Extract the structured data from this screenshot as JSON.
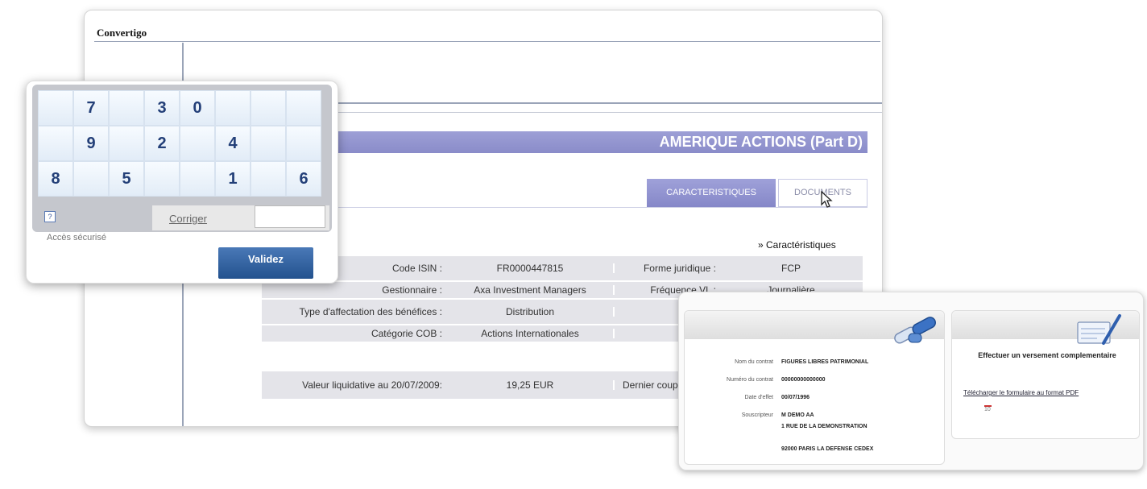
{
  "window": {
    "app_title": "Convertigo"
  },
  "fund": {
    "title": "AMERIQUE ACTIONS (Part D)",
    "tabs": [
      {
        "label": "CARACTERISTIQUES"
      },
      {
        "label": "DOCUMENTS"
      }
    ],
    "section_link": "» Caractéristiques",
    "rows": [
      {
        "label": "Code ISIN :",
        "value": "FR0000447815",
        "label2": "Forme juridique :",
        "value2": "FCP"
      },
      {
        "label": "Gestionnaire :",
        "value": "Axa Investment Managers",
        "label2": "Fréquence VL :",
        "value2": "Journalière"
      },
      {
        "label": "Type d'affectation des bénéfices :",
        "value": "Distribution",
        "label2": "",
        "value2": ""
      },
      {
        "label": "Catégorie COB :",
        "value": "Actions Internationales",
        "label2": "",
        "value2": ""
      }
    ],
    "valeur": {
      "label": "Valeur liquidative au 20/07/2009:",
      "value": "19,25 EUR",
      "label2": "Dernier coupon"
    }
  },
  "keypad": {
    "keys": [
      "",
      "7",
      "",
      "3",
      "0",
      "",
      "",
      "",
      "",
      "9",
      "",
      "2",
      "",
      "4",
      "",
      "",
      "8",
      "",
      "5",
      "",
      "",
      "1",
      "",
      "6"
    ],
    "help_label": "?",
    "corriger_label": "Corriger",
    "code_value": "",
    "acces_label": "Accès sécurisé",
    "validez_label": "Validez"
  },
  "contract": {
    "fields": [
      {
        "label": "Nom du contrat",
        "value": "FIGURES LIBRES PATRIMONIAL"
      },
      {
        "label": "Numéro du contrat",
        "value": "00000000000000"
      },
      {
        "label": "Date d'effet",
        "value": "00/07/1996"
      },
      {
        "label": "Souscripteur",
        "value": "M DEMO AA"
      }
    ],
    "address_line1": "1 RUE DE LA DEMONSTRATION",
    "address_line2": "92000 PARIS LA DEFENSE CEDEX"
  },
  "versement": {
    "title": "Effectuer un versement complementaire",
    "link": "Télécharger le formulaire au format PDF",
    "pdf_size": "10"
  },
  "colors": {
    "banner": "#9d9fd6",
    "validez": "#2f5d98",
    "key_text": "#233f78",
    "table_bg": "#e4e4e9"
  },
  "icons": [
    "pointer-cursor-icon",
    "help-icon",
    "broken-chain-icon",
    "form-pen-icon",
    "pdf-icon"
  ]
}
